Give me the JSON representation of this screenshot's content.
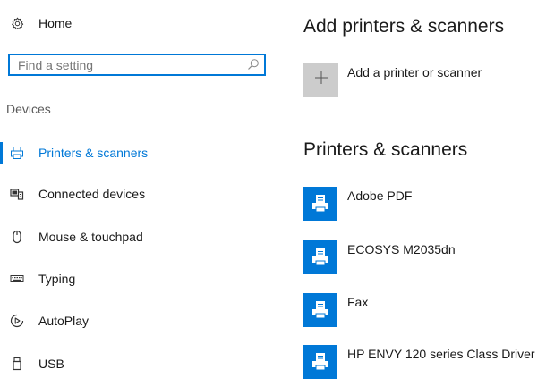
{
  "sidebar": {
    "home_label": "Home",
    "search": {
      "placeholder": "Find a setting",
      "value": ""
    },
    "section_label": "Devices",
    "items": [
      {
        "label": "Printers & scanners",
        "icon": "printer-icon",
        "selected": true
      },
      {
        "label": "Connected devices",
        "icon": "connected-devices-icon",
        "selected": false
      },
      {
        "label": "Mouse & touchpad",
        "icon": "mouse-icon",
        "selected": false
      },
      {
        "label": "Typing",
        "icon": "keyboard-icon",
        "selected": false
      },
      {
        "label": "AutoPlay",
        "icon": "autoplay-icon",
        "selected": false
      },
      {
        "label": "USB",
        "icon": "usb-icon",
        "selected": false
      }
    ]
  },
  "main": {
    "add_section_title": "Add printers & scanners",
    "add_button_label": "Add a printer or scanner",
    "list_section_title": "Printers & scanners",
    "printers": [
      {
        "name": "Adobe PDF"
      },
      {
        "name": "ECOSYS M2035dn"
      },
      {
        "name": "Fax"
      },
      {
        "name": "HP ENVY 120 series Class Driver"
      }
    ]
  },
  "colors": {
    "accent": "#0078d7",
    "tile_gray": "#cccccc",
    "text": "#1a1a1a",
    "muted": "#5a5a5a"
  }
}
